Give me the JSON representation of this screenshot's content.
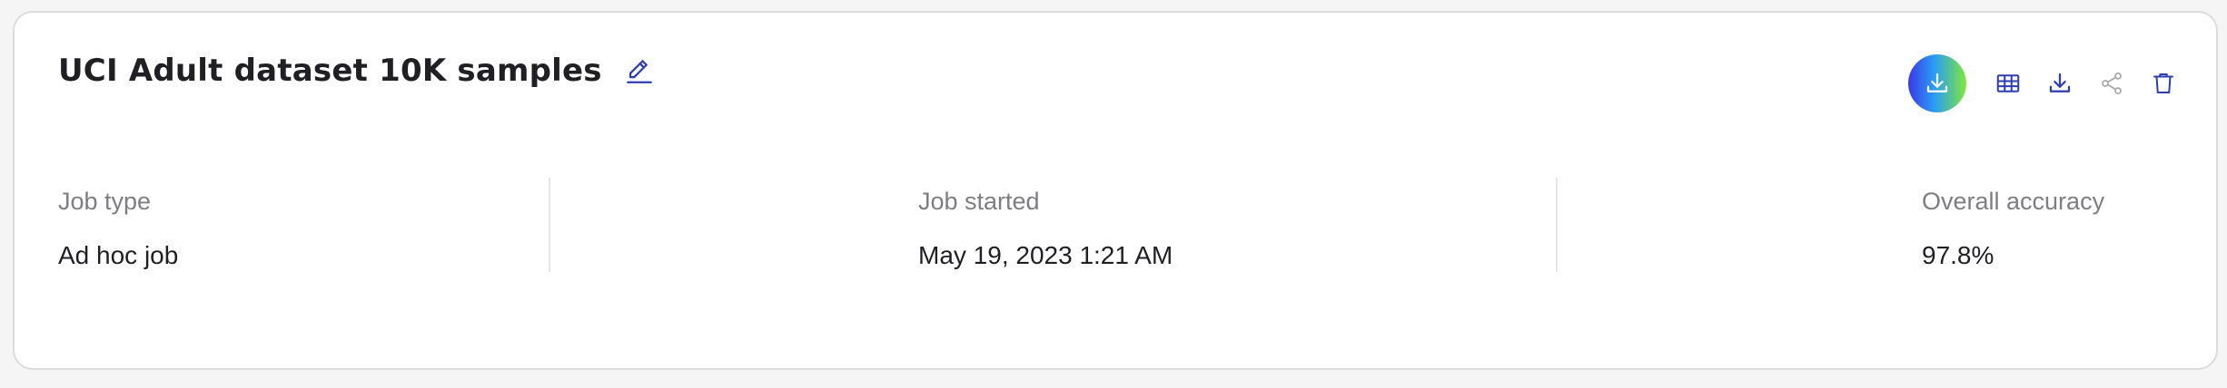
{
  "header": {
    "title": "UCI Adult dataset 10K samples"
  },
  "actions": [
    {
      "name": "download-report",
      "icon": "download-icon"
    },
    {
      "name": "table-view",
      "icon": "table-icon"
    },
    {
      "name": "download",
      "icon": "download-icon"
    },
    {
      "name": "share",
      "icon": "share-icon"
    },
    {
      "name": "delete",
      "icon": "trash-icon"
    }
  ],
  "details": {
    "job_type": {
      "label": "Job type",
      "value": "Ad hoc job"
    },
    "job_started": {
      "label": "Job started",
      "value": "May 19, 2023 1:21 AM"
    },
    "overall_accuracy": {
      "label": "Overall accuracy",
      "value": "97.8%"
    }
  },
  "colors": {
    "accent": "#2d3fb0",
    "muted_icon": "#a9a9ad",
    "gradient": [
      "#3b38e8",
      "#2a9df4",
      "#7ee83a"
    ]
  }
}
